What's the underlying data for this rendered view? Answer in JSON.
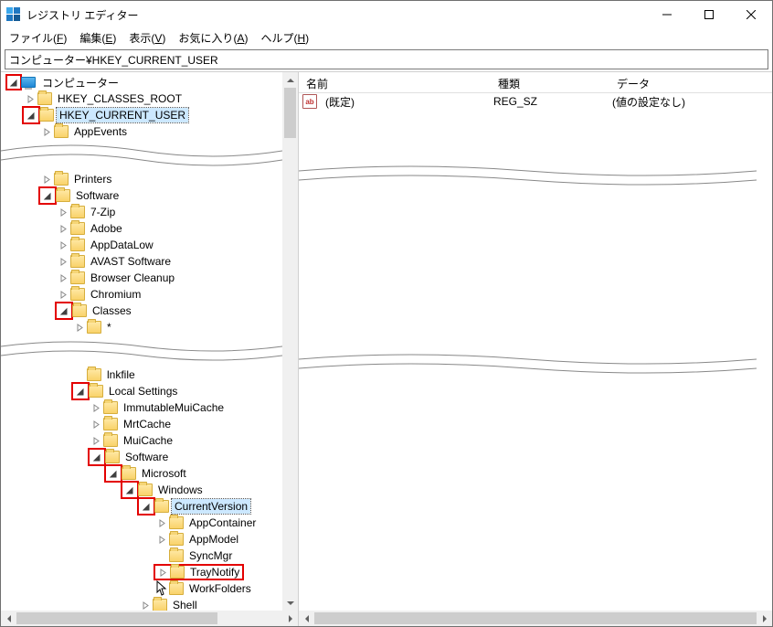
{
  "window_title": "レジストリ エディター",
  "menu": [
    {
      "label": "ファイル",
      "accel": "F"
    },
    {
      "label": "編集",
      "accel": "E"
    },
    {
      "label": "表示",
      "accel": "V"
    },
    {
      "label": "お気に入り",
      "accel": "A"
    },
    {
      "label": "ヘルプ",
      "accel": "H"
    }
  ],
  "address": "コンピューター¥HKEY_CURRENT_USER",
  "list_columns": {
    "c0": "名前",
    "c1": "種類",
    "c2": "データ"
  },
  "list_row": {
    "name": "(既定)",
    "type": "REG_SZ",
    "data": "(値の設定なし)"
  },
  "tree": {
    "root": "コンピューター",
    "hkcr": "HKEY_CLASSES_ROOT",
    "hkcu": "HKEY_CURRENT_USER",
    "appevents": "AppEvents",
    "printers": "Printers",
    "software1": "Software",
    "sevenzip": "7-Zip",
    "adobe": "Adobe",
    "appdatalow": "AppDataLow",
    "avast": "AVAST Software",
    "browsercleanup": "Browser Cleanup",
    "chromium": "Chromium",
    "classes": "Classes",
    "star": "*",
    "lnkfile": "lnkfile",
    "localsettings": "Local Settings",
    "immutable": "ImmutableMuiCache",
    "mrtcache": "MrtCache",
    "muicache": "MuiCache",
    "software2": "Software",
    "microsoft": "Microsoft",
    "windows": "Windows",
    "currentversion": "CurrentVersion",
    "appcontainer": "AppContainer",
    "appmodel": "AppModel",
    "syncmgr": "SyncMgr",
    "traynotify": "TrayNotify",
    "workfolders": "WorkFolders",
    "shell": "Shell"
  }
}
